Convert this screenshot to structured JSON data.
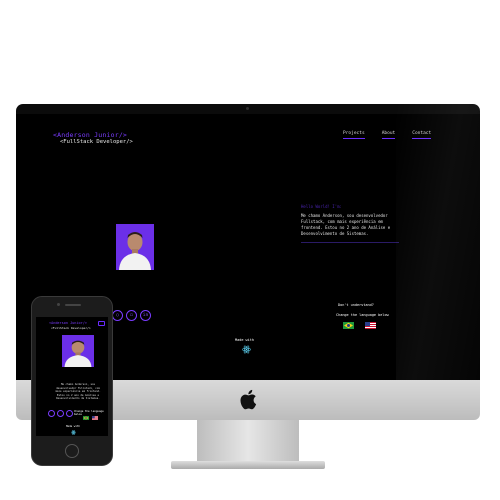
{
  "site": {
    "brand_name": "<Anderson Junior/>",
    "brand_role": "<FullStack Developer/>",
    "nav": [
      {
        "label": "Projects"
      },
      {
        "label": "About"
      },
      {
        "label": "Contact"
      }
    ],
    "about_greeting": "Hello World! I'm:",
    "about_text": "Me chamo Anderson, sou desenvolvedor Fullstack, com mais experiência em frontend. Estou no 2 ano de Análise e Desenvolvimento de Sistemas.",
    "understand_prompt": "Don't understand?",
    "change_language": "Change the language below",
    "made_with": "Made with",
    "social": [
      {
        "icon": "github-icon",
        "glyph": "◯"
      },
      {
        "icon": "instagram-icon",
        "glyph": "◻"
      },
      {
        "icon": "linkedin-icon",
        "glyph": "in"
      }
    ],
    "languages": [
      {
        "name": "Portuguese (Brazil)",
        "icon": "brazil-flag-icon"
      },
      {
        "name": "English (US)",
        "icon": "us-flag-icon"
      }
    ]
  },
  "mobile": {
    "brand_name": "<Anderson Junior/>",
    "brand_role": "<FullStack Developer/>",
    "about_text": "Me chamo Anderson, sou desenvolvedor Fullstack, com mais experiência em frontend. Estou no 2 ano de Análise e Desenvolvimento de Sistemas.",
    "change_language": "Change the language below",
    "made_with": "Made with"
  },
  "colors": {
    "accent": "#7a3cff",
    "background": "#000000",
    "device_silver": "#c8c8c8"
  }
}
